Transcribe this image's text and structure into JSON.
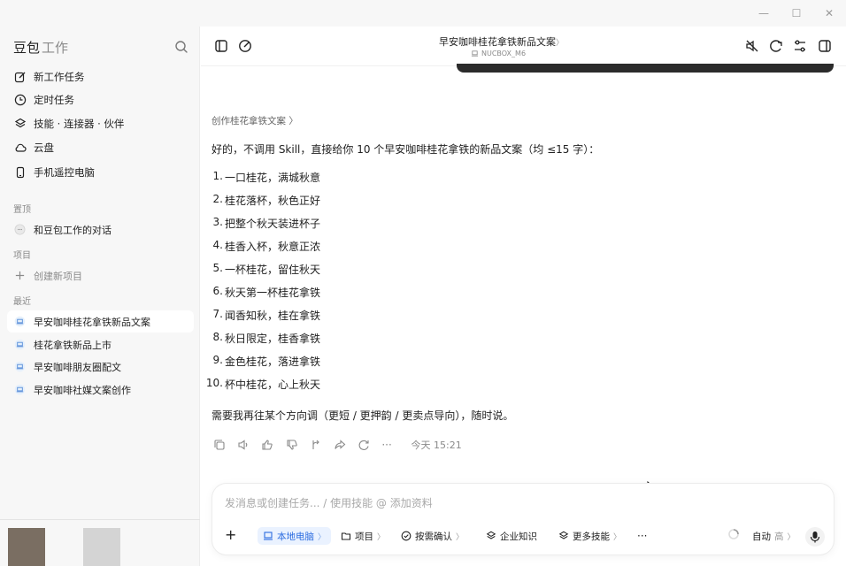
{
  "window": {
    "minimize": "—",
    "maximize": "☐",
    "close": "✕"
  },
  "sidebar": {
    "brand": "豆包",
    "brand_sub": "工作",
    "nav": [
      {
        "label": "新工作任务",
        "icon": "edit-icon"
      },
      {
        "label": "定时任务",
        "icon": "clock-icon"
      },
      {
        "label": "技能 · 连接器 · 伙伴",
        "icon": "layers-icon"
      },
      {
        "label": "云盘",
        "icon": "cloud-icon"
      },
      {
        "label": "手机遥控电脑",
        "icon": "phone-icon"
      }
    ],
    "pinned_label": "置顶",
    "pinned_item": "和豆包工作的对话",
    "projects_label": "项目",
    "new_project": "创建新项目",
    "recent_label": "最近",
    "recent": [
      "早安咖啡桂花拿铁新品文案",
      "桂花拿铁新品上市",
      "早安咖啡朋友圈配文",
      "早安咖啡社媒文案创作"
    ]
  },
  "header": {
    "title": "早安咖啡桂花拿铁新品文案",
    "title_chevron": "〉",
    "device": "NUCBOX_M6"
  },
  "message": {
    "breadcrumb": "创作桂花拿铁文案 〉",
    "intro": "好的，不调用 Skill，直接给你 10 个早安咖啡桂花拿铁的新品文案（均 ≤15 字）：",
    "items": [
      {
        "num": "1.",
        "text": "一口桂花，满城秋意"
      },
      {
        "num": "2.",
        "text": "桂花落杯，秋色正好"
      },
      {
        "num": "3.",
        "text": "把整个秋天装进杯子"
      },
      {
        "num": "4.",
        "text": "桂香入杯，秋意正浓"
      },
      {
        "num": "5.",
        "text": "一杯桂花，留住秋天"
      },
      {
        "num": "6.",
        "text": "秋天第一杯桂花拿铁"
      },
      {
        "num": "7.",
        "text": "闻香知秋，桂在拿铁"
      },
      {
        "num": "8.",
        "text": "秋日限定，桂香拿铁"
      },
      {
        "num": "9.",
        "text": "金色桂花，落进拿铁"
      },
      {
        "num": "10.",
        "text": "杯中桂花，心上秋天"
      }
    ],
    "outro": "需要我再往某个方向调（更短 / 更押韵 / 更卖点导向），随时说。",
    "timestamp": "今天 15:21",
    "more": "···"
  },
  "composer": {
    "placeholder": "发消息或创建任务... / 使用技能 @ 添加资料",
    "add": "+",
    "local": "本地电脑",
    "project": "项目",
    "confirm": "按需确认",
    "enterprise": "企业知识",
    "more_skills": "更多技能",
    "more": "···",
    "mode": "自动",
    "level": "高",
    "chev": "〉"
  },
  "colors": {
    "accent": "#2b6ce0",
    "sidebar_bg": "#f7f7f7",
    "local_chip_bg": "#eaf2ff"
  }
}
